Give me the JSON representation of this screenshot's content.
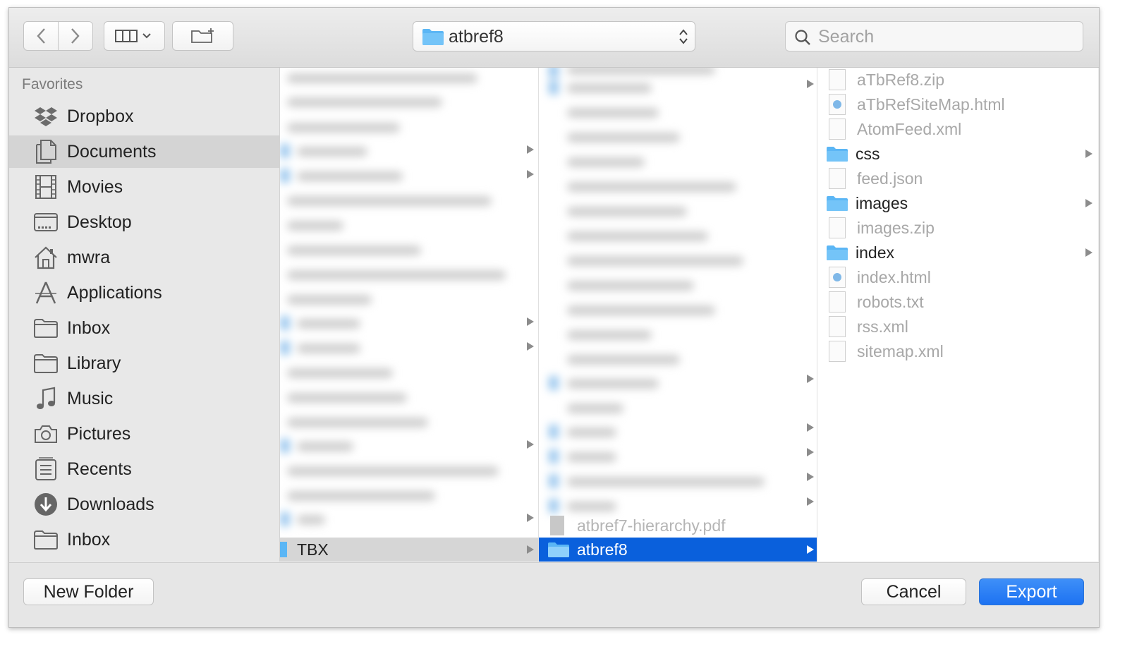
{
  "toolbar": {
    "path_label": "atbref8",
    "search_placeholder": "Search"
  },
  "sidebar": {
    "header": "Favorites",
    "items": [
      {
        "label": "Dropbox",
        "icon": "dropbox-icon"
      },
      {
        "label": "Documents",
        "icon": "documents-icon",
        "selected": true
      },
      {
        "label": "Movies",
        "icon": "film-icon"
      },
      {
        "label": "Desktop",
        "icon": "desktop-icon"
      },
      {
        "label": "mwra",
        "icon": "home-icon"
      },
      {
        "label": "Applications",
        "icon": "applications-icon"
      },
      {
        "label": "Inbox",
        "icon": "folder-icon"
      },
      {
        "label": "Library",
        "icon": "folder-icon"
      },
      {
        "label": "Music",
        "icon": "music-note-icon"
      },
      {
        "label": "Pictures",
        "icon": "camera-icon"
      },
      {
        "label": "Recents",
        "icon": "recents-icon"
      },
      {
        "label": "Downloads",
        "icon": "download-icon"
      },
      {
        "label": "Inbox",
        "icon": "folder-icon"
      }
    ]
  },
  "column1": {
    "visible_items": [
      {
        "label": "TBX",
        "type": "folder",
        "selected": true
      }
    ]
  },
  "column2": {
    "visible_items": [
      {
        "label": "atbref7-hierarchy.pdf",
        "type": "file",
        "dimmed": true
      },
      {
        "label": "atbref8",
        "type": "folder",
        "selected": true
      }
    ]
  },
  "column3": {
    "items": [
      {
        "label": "aTbRef8.zip",
        "type": "zip",
        "dimmed": true
      },
      {
        "label": "aTbRefSiteMap.html",
        "type": "html",
        "dimmed": true
      },
      {
        "label": "AtomFeed.xml",
        "type": "file",
        "dimmed": true
      },
      {
        "label": "css",
        "type": "folder",
        "dimmed": false
      },
      {
        "label": "feed.json",
        "type": "file",
        "dimmed": true
      },
      {
        "label": "images",
        "type": "folder",
        "dimmed": false
      },
      {
        "label": "images.zip",
        "type": "zip",
        "dimmed": true
      },
      {
        "label": "index",
        "type": "folder",
        "dimmed": false
      },
      {
        "label": "index.html",
        "type": "html",
        "dimmed": true
      },
      {
        "label": "robots.txt",
        "type": "text",
        "dimmed": true
      },
      {
        "label": "rss.xml",
        "type": "file",
        "dimmed": true
      },
      {
        "label": "sitemap.xml",
        "type": "file",
        "dimmed": true
      }
    ]
  },
  "buttons": {
    "new_folder": "New Folder",
    "cancel": "Cancel",
    "export": "Export"
  },
  "colors": {
    "selection": "#0a60dc",
    "folder": "#5bb6f5",
    "primary_button": "#1d72f2"
  }
}
